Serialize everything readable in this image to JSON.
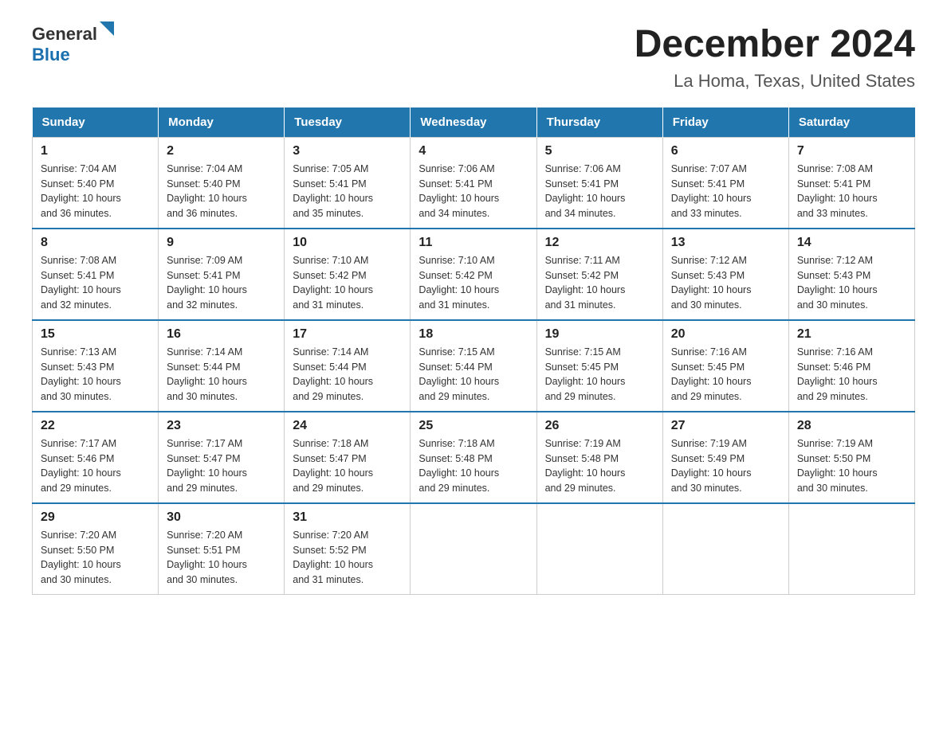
{
  "logo": {
    "general": "General",
    "blue": "Blue"
  },
  "title": "December 2024",
  "subtitle": "La Homa, Texas, United States",
  "days_of_week": [
    "Sunday",
    "Monday",
    "Tuesday",
    "Wednesday",
    "Thursday",
    "Friday",
    "Saturday"
  ],
  "weeks": [
    [
      {
        "day": "1",
        "sunrise": "7:04 AM",
        "sunset": "5:40 PM",
        "daylight": "10 hours and 36 minutes."
      },
      {
        "day": "2",
        "sunrise": "7:04 AM",
        "sunset": "5:40 PM",
        "daylight": "10 hours and 36 minutes."
      },
      {
        "day": "3",
        "sunrise": "7:05 AM",
        "sunset": "5:41 PM",
        "daylight": "10 hours and 35 minutes."
      },
      {
        "day": "4",
        "sunrise": "7:06 AM",
        "sunset": "5:41 PM",
        "daylight": "10 hours and 34 minutes."
      },
      {
        "day": "5",
        "sunrise": "7:06 AM",
        "sunset": "5:41 PM",
        "daylight": "10 hours and 34 minutes."
      },
      {
        "day": "6",
        "sunrise": "7:07 AM",
        "sunset": "5:41 PM",
        "daylight": "10 hours and 33 minutes."
      },
      {
        "day": "7",
        "sunrise": "7:08 AM",
        "sunset": "5:41 PM",
        "daylight": "10 hours and 33 minutes."
      }
    ],
    [
      {
        "day": "8",
        "sunrise": "7:08 AM",
        "sunset": "5:41 PM",
        "daylight": "10 hours and 32 minutes."
      },
      {
        "day": "9",
        "sunrise": "7:09 AM",
        "sunset": "5:41 PM",
        "daylight": "10 hours and 32 minutes."
      },
      {
        "day": "10",
        "sunrise": "7:10 AM",
        "sunset": "5:42 PM",
        "daylight": "10 hours and 31 minutes."
      },
      {
        "day": "11",
        "sunrise": "7:10 AM",
        "sunset": "5:42 PM",
        "daylight": "10 hours and 31 minutes."
      },
      {
        "day": "12",
        "sunrise": "7:11 AM",
        "sunset": "5:42 PM",
        "daylight": "10 hours and 31 minutes."
      },
      {
        "day": "13",
        "sunrise": "7:12 AM",
        "sunset": "5:43 PM",
        "daylight": "10 hours and 30 minutes."
      },
      {
        "day": "14",
        "sunrise": "7:12 AM",
        "sunset": "5:43 PM",
        "daylight": "10 hours and 30 minutes."
      }
    ],
    [
      {
        "day": "15",
        "sunrise": "7:13 AM",
        "sunset": "5:43 PM",
        "daylight": "10 hours and 30 minutes."
      },
      {
        "day": "16",
        "sunrise": "7:14 AM",
        "sunset": "5:44 PM",
        "daylight": "10 hours and 30 minutes."
      },
      {
        "day": "17",
        "sunrise": "7:14 AM",
        "sunset": "5:44 PM",
        "daylight": "10 hours and 29 minutes."
      },
      {
        "day": "18",
        "sunrise": "7:15 AM",
        "sunset": "5:44 PM",
        "daylight": "10 hours and 29 minutes."
      },
      {
        "day": "19",
        "sunrise": "7:15 AM",
        "sunset": "5:45 PM",
        "daylight": "10 hours and 29 minutes."
      },
      {
        "day": "20",
        "sunrise": "7:16 AM",
        "sunset": "5:45 PM",
        "daylight": "10 hours and 29 minutes."
      },
      {
        "day": "21",
        "sunrise": "7:16 AM",
        "sunset": "5:46 PM",
        "daylight": "10 hours and 29 minutes."
      }
    ],
    [
      {
        "day": "22",
        "sunrise": "7:17 AM",
        "sunset": "5:46 PM",
        "daylight": "10 hours and 29 minutes."
      },
      {
        "day": "23",
        "sunrise": "7:17 AM",
        "sunset": "5:47 PM",
        "daylight": "10 hours and 29 minutes."
      },
      {
        "day": "24",
        "sunrise": "7:18 AM",
        "sunset": "5:47 PM",
        "daylight": "10 hours and 29 minutes."
      },
      {
        "day": "25",
        "sunrise": "7:18 AM",
        "sunset": "5:48 PM",
        "daylight": "10 hours and 29 minutes."
      },
      {
        "day": "26",
        "sunrise": "7:19 AM",
        "sunset": "5:48 PM",
        "daylight": "10 hours and 29 minutes."
      },
      {
        "day": "27",
        "sunrise": "7:19 AM",
        "sunset": "5:49 PM",
        "daylight": "10 hours and 30 minutes."
      },
      {
        "day": "28",
        "sunrise": "7:19 AM",
        "sunset": "5:50 PM",
        "daylight": "10 hours and 30 minutes."
      }
    ],
    [
      {
        "day": "29",
        "sunrise": "7:20 AM",
        "sunset": "5:50 PM",
        "daylight": "10 hours and 30 minutes."
      },
      {
        "day": "30",
        "sunrise": "7:20 AM",
        "sunset": "5:51 PM",
        "daylight": "10 hours and 30 minutes."
      },
      {
        "day": "31",
        "sunrise": "7:20 AM",
        "sunset": "5:52 PM",
        "daylight": "10 hours and 31 minutes."
      },
      {
        "day": "",
        "sunrise": "",
        "sunset": "",
        "daylight": ""
      },
      {
        "day": "",
        "sunrise": "",
        "sunset": "",
        "daylight": ""
      },
      {
        "day": "",
        "sunrise": "",
        "sunset": "",
        "daylight": ""
      },
      {
        "day": "",
        "sunrise": "",
        "sunset": "",
        "daylight": ""
      }
    ]
  ],
  "cell_labels": {
    "sunrise": "Sunrise: ",
    "sunset": "Sunset: ",
    "daylight": "Daylight: "
  }
}
